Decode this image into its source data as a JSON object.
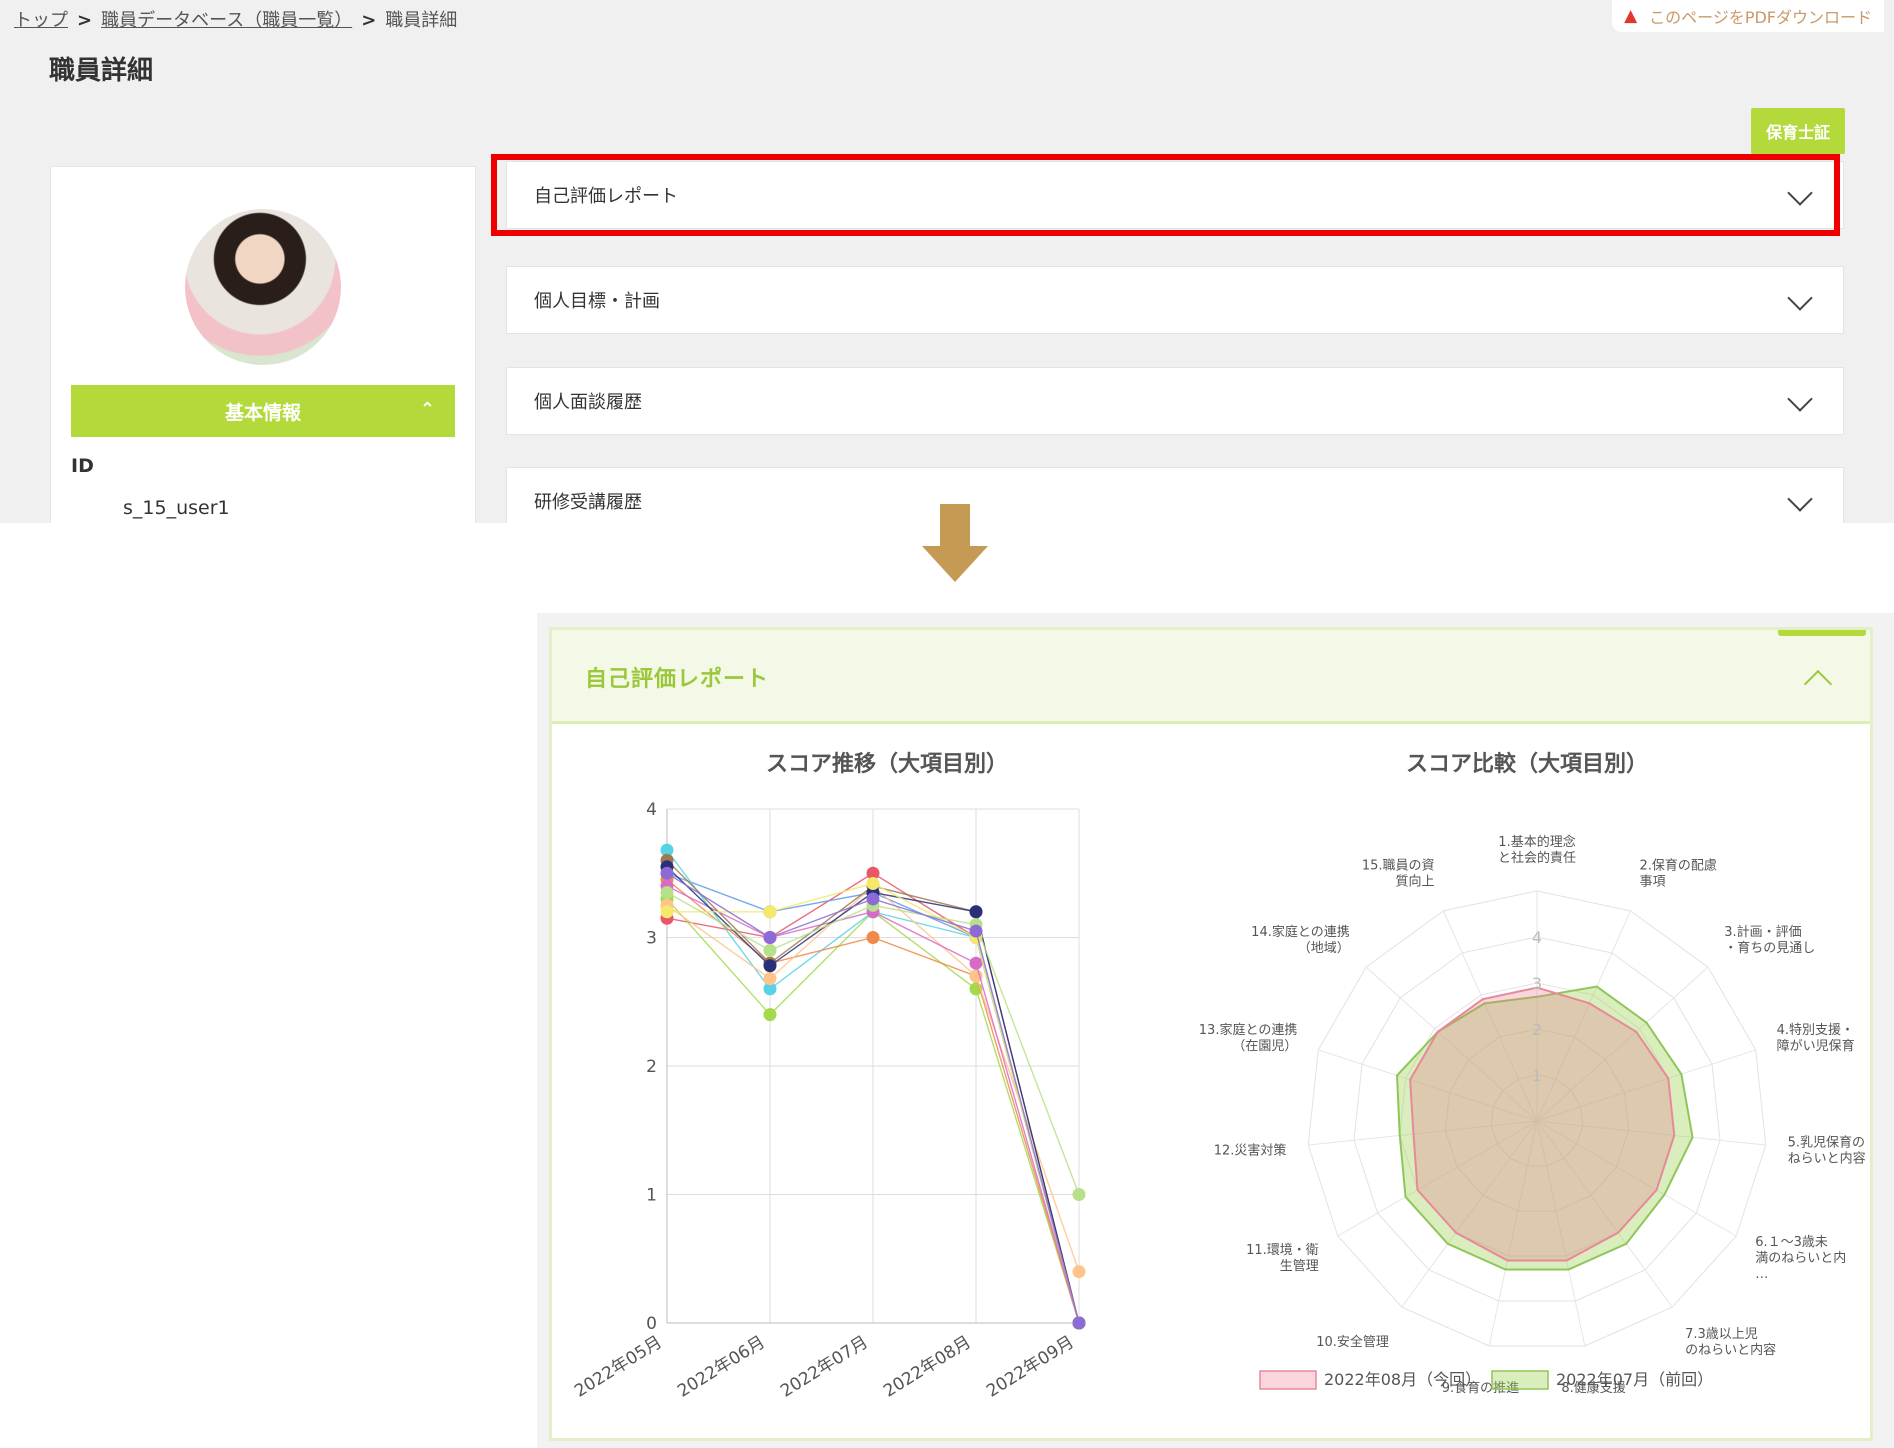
{
  "breadcrumb": {
    "top": "トップ",
    "db": "職員データベース（職員一覧）",
    "current": "職員詳細",
    "sep": ">"
  },
  "pdf_download": "このページをPDFダウンロード",
  "page_title": "職員詳細",
  "badge": "保育士証",
  "profile": {
    "basic_label": "基本情報",
    "id_label": "ID",
    "id_value": "s_15_user1"
  },
  "accordions": [
    "自己評価レポート",
    "個人目標・計画",
    "個人面談履歴",
    "研修受講履歴"
  ],
  "report": {
    "header": "自己評価レポート"
  },
  "chart_data": [
    {
      "type": "line",
      "title": "スコア推移（大項目別）",
      "categories": [
        "2022年05月",
        "2022年06月",
        "2022年07月",
        "2022年08月",
        "2022年09月"
      ],
      "ylim": [
        0,
        4
      ],
      "yticks": [
        "0",
        "1",
        "2",
        "3",
        "4"
      ],
      "grid": true,
      "series": [
        {
          "color": "#e8566a",
          "values": [
            3.15,
            3.0,
            3.5,
            3.0,
            0
          ]
        },
        {
          "color": "#5b9be6",
          "values": [
            3.5,
            3.2,
            3.35,
            3.0,
            0
          ]
        },
        {
          "color": "#5ad2e6",
          "values": [
            3.68,
            2.6,
            3.2,
            3.0,
            0
          ]
        },
        {
          "color": "#a3d94b",
          "values": [
            3.3,
            2.4,
            3.2,
            2.6,
            0
          ]
        },
        {
          "color": "#f08a4b",
          "values": [
            3.45,
            2.8,
            3.0,
            2.7,
            0
          ]
        },
        {
          "color": "#ffc48a",
          "values": [
            3.25,
            2.68,
            3.4,
            2.7,
            0.4
          ]
        },
        {
          "color": "#d86bc8",
          "values": [
            3.4,
            3.0,
            3.2,
            2.8,
            0
          ]
        },
        {
          "color": "#9a7a4f",
          "values": [
            3.6,
            2.8,
            3.4,
            3.2,
            0
          ]
        },
        {
          "color": "#2a2f7a",
          "values": [
            3.55,
            2.78,
            3.35,
            3.2,
            0
          ]
        },
        {
          "color": "#f5e86a",
          "values": [
            3.2,
            3.2,
            3.42,
            3.0,
            0
          ]
        },
        {
          "color": "#b7e08a",
          "values": [
            3.35,
            2.9,
            3.25,
            3.1,
            1.0
          ]
        },
        {
          "color": "#8c6bd6",
          "values": [
            3.5,
            3.0,
            3.3,
            3.05,
            0
          ]
        }
      ]
    },
    {
      "type": "radar",
      "title": "スコア比較（大項目別）",
      "axes": [
        [
          "1.基本的理念",
          "と社会的責任"
        ],
        [
          "2.保育の配慮",
          "事項"
        ],
        [
          "3.計画・評価",
          "・育ちの見通し"
        ],
        [
          "4.特別支援・",
          "障がい児保育"
        ],
        [
          "5.乳児保育の",
          "ねらいと内容"
        ],
        [
          "6.１～3歳未",
          "満のねらいと内",
          "…"
        ],
        [
          "7.3歳以上児",
          "のねらいと内容"
        ],
        [
          "8.健康支援"
        ],
        [
          "9.食育の推進"
        ],
        [
          "10.安全管理"
        ],
        [
          "11.環境・衛",
          "生管理"
        ],
        [
          "12.災害対策"
        ],
        [
          "13.家庭との連携",
          "（在園児）"
        ],
        [
          "14.家庭との連携",
          "（地域）"
        ],
        [
          "15.職員の資",
          "質向上"
        ]
      ],
      "rticks": [
        "1",
        "2",
        "3",
        "4"
      ],
      "rlim": [
        0,
        4
      ],
      "series": [
        {
          "name": "2022年08月（今回）",
          "color": "#e8889a",
          "fill": "rgba(232,120,140,0.30)",
          "values": [
            2.9,
            2.8,
            2.9,
            3.0,
            3.0,
            3.0,
            3.0,
            3.1,
            3.1,
            3.0,
            3.0,
            2.7,
            2.9,
            2.9,
            2.9
          ]
        },
        {
          "name": "2022年07月（前回）",
          "color": "#8fc65a",
          "fill": "rgba(160,210,90,0.40)",
          "values": [
            2.7,
            3.2,
            3.2,
            3.3,
            3.4,
            3.2,
            3.3,
            3.3,
            3.3,
            3.3,
            3.3,
            3.0,
            3.2,
            2.9,
            2.8
          ]
        }
      ]
    }
  ]
}
